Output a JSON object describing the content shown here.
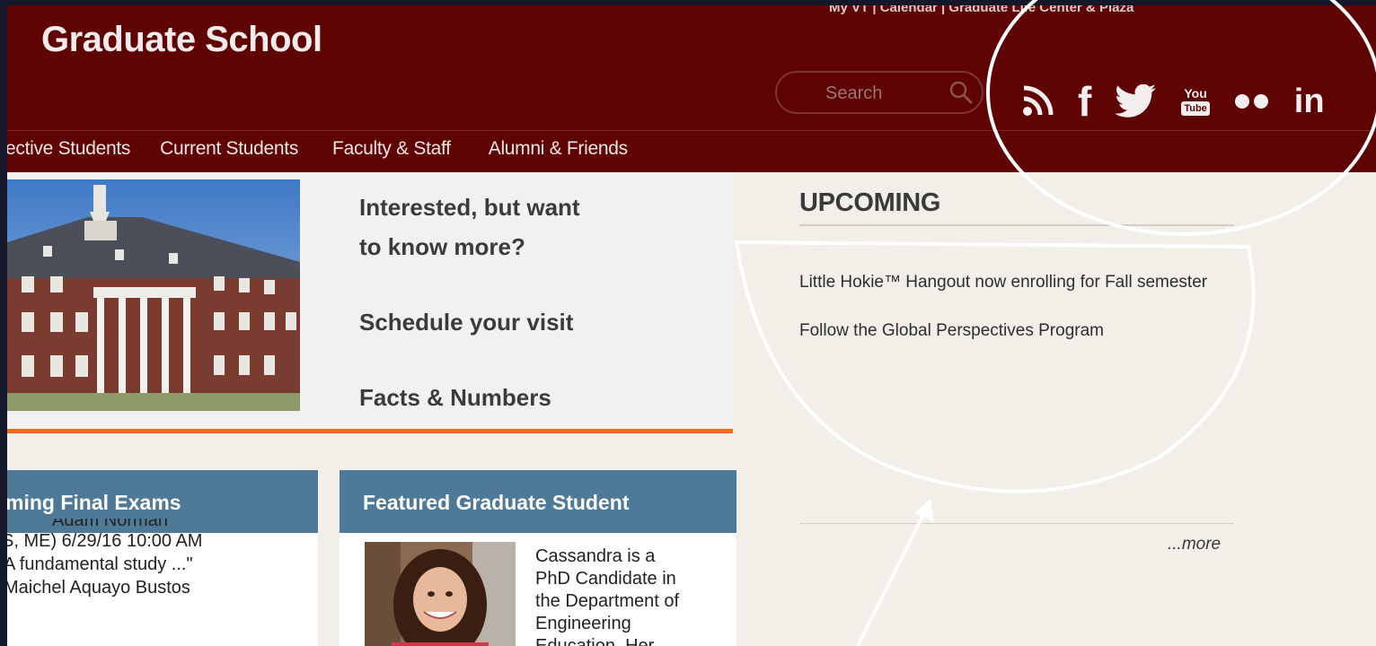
{
  "header": {
    "title": "Graduate School",
    "toplinks": "My VT | Calendar | Graduate Life Center & Plaza"
  },
  "search": {
    "placeholder": "Search"
  },
  "social": {
    "icons": [
      "rss-icon",
      "facebook-icon",
      "twitter-icon",
      "youtube-icon",
      "flickr-icon",
      "linkedin-icon"
    ],
    "youtube_top": "You",
    "youtube_bottom": "Tube",
    "linkedin": "in",
    "facebook": "f"
  },
  "nav": {
    "items": [
      "ective Students",
      "Current Students",
      "Faculty & Staff",
      "Alumni & Friends"
    ]
  },
  "promo": {
    "line1": "Interested, but want",
    "line2": "to know more?",
    "visit": "Schedule your visit",
    "facts": "Facts & Numbers"
  },
  "cards": {
    "exams_title": "ming Final Exams",
    "exams_lines": [
      "Adam Norman",
      "S, ME) 6/29/16 10:00 AM",
      "A fundamental study ...\"",
      "Maichel Aquayo Bustos"
    ],
    "student_title": "Featured Graduate Student",
    "student_lines": [
      "Cassandra is a",
      "PhD Candidate in",
      "the Department of",
      "Engineering",
      "Education. Her"
    ]
  },
  "upcoming": {
    "title": "UPCOMING",
    "items": [
      "Little Hokie™ Hangout now enrolling for Fall semester",
      "Follow the Global Perspectives Program"
    ],
    "more": "...more"
  },
  "colors": {
    "header_bg": "#5e0202",
    "card_header": "#4e7a98",
    "accent_orange": "#f26a1b",
    "sidebar_bg": "#f1efe8"
  }
}
